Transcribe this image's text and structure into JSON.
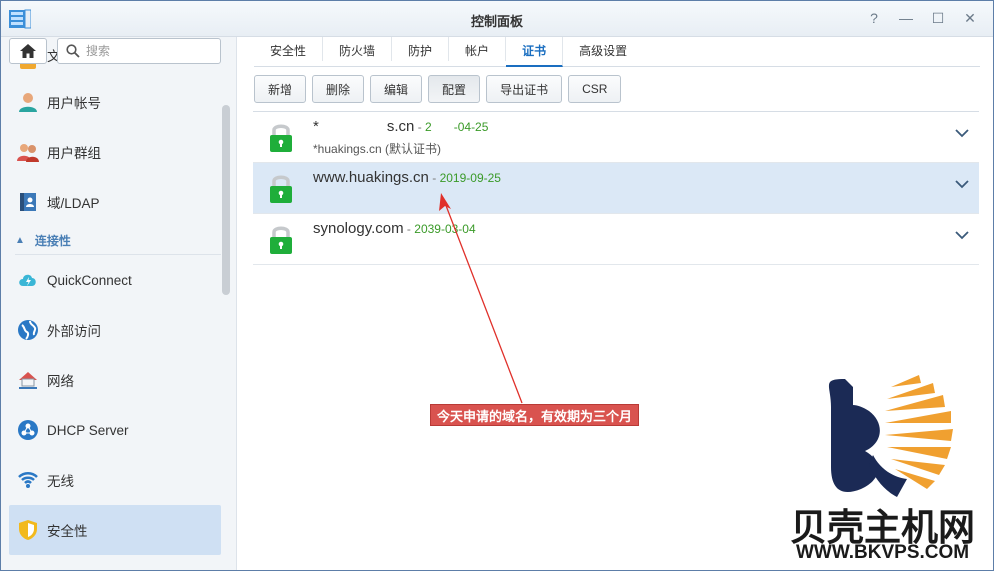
{
  "window": {
    "title": "控制面板",
    "controls": {
      "help": "?",
      "minimize": "—",
      "maximize": "☐",
      "close": "✕"
    }
  },
  "sidebar": {
    "search_placeholder": "搜索",
    "items_top": [
      {
        "label": "文件服务",
        "icon": "file-service-icon"
      },
      {
        "label": "用户帐号",
        "icon": "user-icon"
      },
      {
        "label": "用户群组",
        "icon": "group-icon"
      },
      {
        "label": "域/LDAP",
        "icon": "ldap-icon"
      }
    ],
    "section": {
      "label": "连接性"
    },
    "items_conn": [
      {
        "label": "QuickConnect",
        "icon": "quickconnect-icon"
      },
      {
        "label": "外部访问",
        "icon": "external-access-icon"
      },
      {
        "label": "网络",
        "icon": "network-icon"
      },
      {
        "label": "DHCP Server",
        "icon": "dhcp-icon"
      },
      {
        "label": "无线",
        "icon": "wireless-icon"
      },
      {
        "label": "安全性",
        "icon": "security-shield-icon",
        "active": true
      }
    ]
  },
  "tabs": [
    {
      "label": "安全性"
    },
    {
      "label": "防火墙"
    },
    {
      "label": "防护"
    },
    {
      "label": "帐户"
    },
    {
      "label": "证书",
      "active": true
    },
    {
      "label": "高级设置"
    }
  ],
  "toolbar": {
    "add": "新增",
    "delete": "删除",
    "edit": "编辑",
    "configure": "配置",
    "export": "导出证书",
    "csr": "CSR"
  },
  "certificates": [
    {
      "name_a": "*",
      "name_b": "s.cn",
      "sep": " - ",
      "date_a": "2",
      "date_b": "-04-25",
      "subtitle": "*huakings.cn (默认证书)"
    },
    {
      "name": "www.huakings.cn",
      "sep": " - ",
      "date": "2019-09-25",
      "subtitle": ""
    },
    {
      "name": "synology.com",
      "sep": " - ",
      "date": "2039-03-04",
      "subtitle": ""
    }
  ],
  "annotation": {
    "text": "今天申请的域名，有效期为三个月"
  },
  "watermark": {
    "cn": "贝壳主机网",
    "en": "WWW.BKVPS.COM"
  },
  "colors": {
    "accent": "#1a6ec0",
    "date_green": "#3a9a28",
    "lock_green": "#1fae3a",
    "selected_row": "#dbe8f6",
    "annotation_red": "#d9534f"
  }
}
